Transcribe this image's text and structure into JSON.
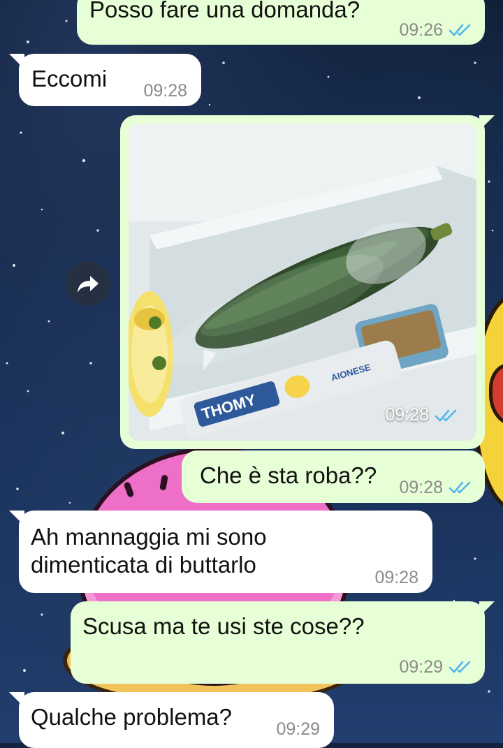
{
  "conversation": {
    "messages": [
      {
        "direction": "out",
        "text": "Posso fare una domanda?",
        "time": "09:26",
        "status": "read"
      },
      {
        "direction": "in",
        "text": "Eccomi",
        "time": "09:28"
      },
      {
        "direction": "out",
        "type": "image",
        "time": "09:28",
        "status": "read",
        "image_labels": {
          "brand": "THOMY",
          "side_text": "AIONESE"
        }
      },
      {
        "direction": "out",
        "text": "Che è sta roba??",
        "time": "09:28",
        "status": "read"
      },
      {
        "direction": "in",
        "text": "Ah mannaggia mi sono\ndimenticata di buttarlo",
        "time": "09:28"
      },
      {
        "direction": "out",
        "text": "Scusa ma te usi ste cose??",
        "time": "09:29",
        "status": "read"
      },
      {
        "direction": "in",
        "text": "Qualche problema?",
        "time": "09:29"
      }
    ]
  },
  "icons": {
    "read_status": "double-check-icon",
    "forward": "forward-arrow-icon"
  },
  "colors": {
    "outgoing_bubble": "#e7ffd6",
    "incoming_bubble": "#ffffff",
    "read_ticks": "#4fb6ec",
    "timestamp": "#8a8a8a"
  }
}
